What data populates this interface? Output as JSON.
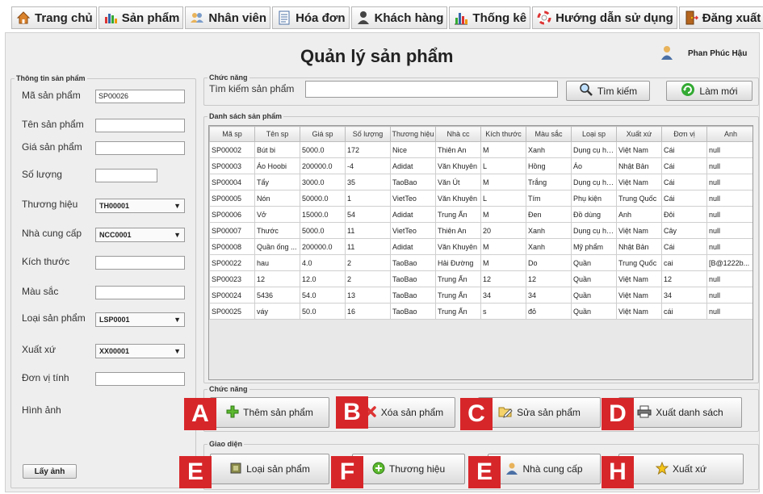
{
  "menu": [
    {
      "label": "Trang chủ",
      "icon": "home-icon"
    },
    {
      "label": "Sản phẩm",
      "icon": "bar-chart-icon"
    },
    {
      "label": "Nhân viên",
      "icon": "users-icon"
    },
    {
      "label": "Hóa đơn",
      "icon": "invoice-icon"
    },
    {
      "label": "Khách hàng",
      "icon": "person-icon"
    },
    {
      "label": "Thống kê",
      "icon": "statistics-icon"
    },
    {
      "label": "Hướng dẫn sử dụng",
      "icon": "lifebuoy-icon"
    },
    {
      "label": "Đăng xuất",
      "icon": "logout-door-icon"
    }
  ],
  "page_title": "Quản lý sản phẩm",
  "user_name": "Phan Phúc Hậu",
  "product_info": {
    "legend": "Thông tin sản phẩm",
    "fields": {
      "code": {
        "label": "Mã sản phẩm",
        "value": "SP00026"
      },
      "name": {
        "label": "Tên sản phẩm",
        "value": ""
      },
      "price": {
        "label": "Giá sản phẩm",
        "value": ""
      },
      "quantity": {
        "label": "Số lượng",
        "value": ""
      },
      "brand": {
        "label": "Thương hiệu",
        "value": "TH00001"
      },
      "supplier": {
        "label": "Nhà cung cấp",
        "value": "NCC0001"
      },
      "size": {
        "label": "Kích thước",
        "value": ""
      },
      "color": {
        "label": "Màu sắc",
        "value": ""
      },
      "type": {
        "label": "Loại sản phẩm",
        "value": "LSP0001"
      },
      "origin": {
        "label": "Xuất xứ",
        "value": "XX00001"
      },
      "unit": {
        "label": "Đơn vị tính",
        "value": ""
      },
      "image": {
        "label": "Hình ảnh"
      }
    },
    "get_image_label": "Lấy ảnh"
  },
  "search": {
    "legend": "Chức năng",
    "label": "Tìm kiếm sản phẩm",
    "value": "",
    "search_label": "Tìm kiếm",
    "refresh_label": "Làm mới"
  },
  "list": {
    "legend": "Danh sách sản phẩm",
    "columns": [
      "Mã sp",
      "Tên sp",
      "Giá sp",
      "Số lượng",
      "Thương hiệu",
      "Nhà cc",
      "Kích thước",
      "Màu sắc",
      "Loại sp",
      "Xuất xứ",
      "Đơn vị",
      "Anh"
    ],
    "rows": [
      [
        "SP00002",
        "Bút bi",
        "5000.0",
        "172",
        "Nice",
        "Thiên An",
        "M",
        "Xanh",
        "Dụng cụ họ...",
        "Việt Nam",
        "Cái",
        "null"
      ],
      [
        "SP00003",
        "Áo Hoobi",
        "200000.0",
        "-4",
        "Adidat",
        "Văn Khuyên",
        "L",
        "Hồng",
        "Áo",
        "Nhật Bản",
        "Cái",
        "null"
      ],
      [
        "SP00004",
        "Tẩy",
        "3000.0",
        "35",
        "TaoBao",
        "Văn Út",
        "M",
        "Trắng",
        "Dụng cụ họ...",
        "Việt Nam",
        "Cái",
        "null"
      ],
      [
        "SP00005",
        "Nón",
        "50000.0",
        "1",
        "VietTeo",
        "Văn Khuyên",
        "L",
        "Tím",
        "Phụ kiện",
        "Trung Quốc",
        "Cái",
        "null"
      ],
      [
        "SP00006",
        "Vở",
        "15000.0",
        "54",
        "Adidat",
        "Trung Ấn",
        "M",
        "Đen",
        "Đồ dùng",
        "Anh",
        "Đôi",
        "null"
      ],
      [
        "SP00007",
        "Thước",
        "5000.0",
        "11",
        "VietTeo",
        "Thiên An",
        "20",
        "Xanh",
        "Dụng cụ họ...",
        "Việt Nam",
        "Cây",
        "null"
      ],
      [
        "SP00008",
        "Quần ống ...",
        "200000.0",
        "11",
        "Adidat",
        "Văn Khuyên",
        "M",
        "Xanh",
        "Mỹ phẩm",
        "Nhật Bản",
        "Cái",
        "null"
      ],
      [
        "SP00022",
        "hau",
        "4.0",
        "2",
        "TaoBao",
        "Hải Đường",
        "M",
        "Do",
        "Quần",
        "Trung Quốc",
        "cai",
        "[B@1222b..."
      ],
      [
        "SP00023",
        "12",
        "12.0",
        "2",
        "TaoBao",
        "Trung Ấn",
        "12",
        "12",
        "Quần",
        "Việt Nam",
        "12",
        "null"
      ],
      [
        "SP00024",
        "5436",
        "54.0",
        "13",
        "TaoBao",
        "Trung Ấn",
        "34",
        "34",
        "Quần",
        "Việt Nam",
        "34",
        "null"
      ],
      [
        "SP00025",
        "váy",
        "50.0",
        "16",
        "TaoBao",
        "Trung Ấn",
        "s",
        "đỏ",
        "Quần",
        "Việt Nam",
        "cái",
        "null"
      ]
    ]
  },
  "functions": {
    "legend": "Chức năng",
    "add_label": "Thêm sản phẩm",
    "delete_label": "Xóa sản phẩm",
    "edit_label": "Sửa sản phẩm",
    "export_label": "Xuất danh sách"
  },
  "interface": {
    "legend": "Giao diện",
    "type_label": "Loại sản phẩm",
    "brand_label": "Thương hiệu",
    "supplier_label": "Nhà cung cấp",
    "origin_label": "Xuất xứ"
  },
  "badges": [
    "A",
    "B",
    "C",
    "D",
    "E",
    "F",
    "E",
    "H"
  ],
  "colors": {
    "badge": "#d7262a",
    "panel": "#eeeeee"
  }
}
